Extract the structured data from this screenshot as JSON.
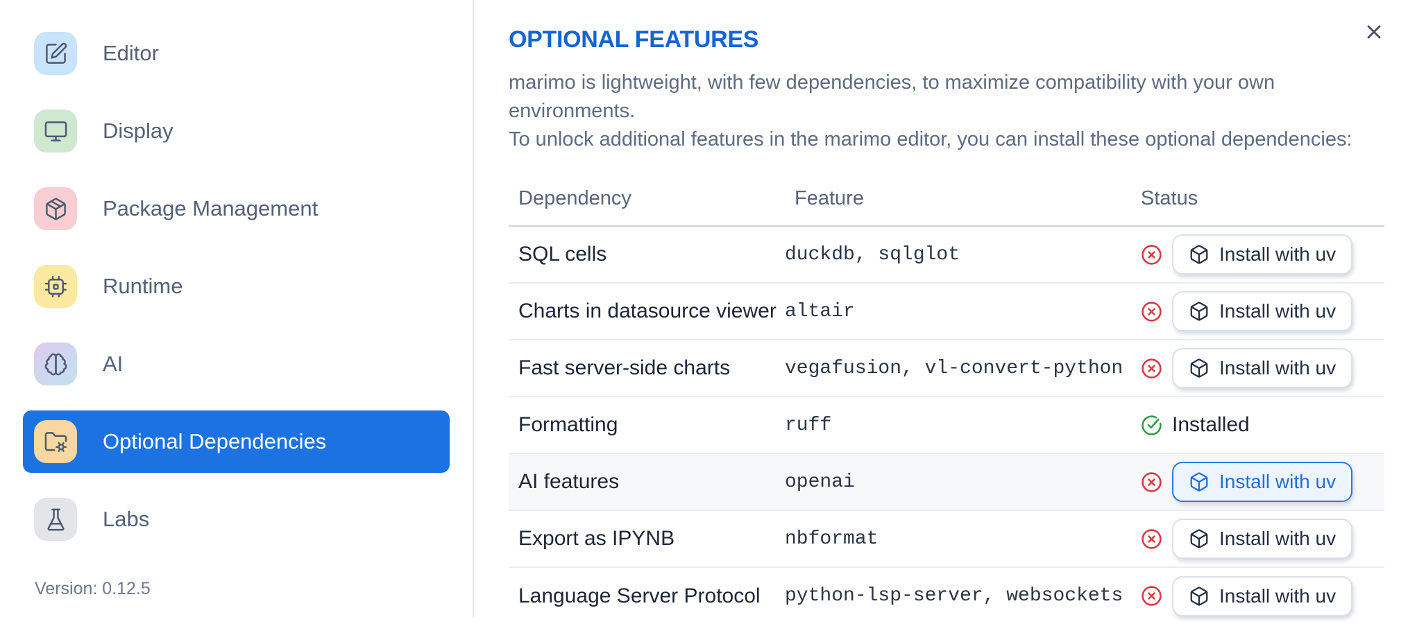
{
  "sidebar": {
    "items": [
      {
        "label": "Editor",
        "icon": "edit",
        "icon_bg": "#c8e4fa",
        "selected": false
      },
      {
        "label": "Display",
        "icon": "monitor",
        "icon_bg": "#cfe9d1",
        "selected": false
      },
      {
        "label": "Package Management",
        "icon": "package",
        "icon_bg": "#f9ced2",
        "selected": false
      },
      {
        "label": "Runtime",
        "icon": "cpu",
        "icon_bg": "#fbe8a1",
        "selected": false
      },
      {
        "label": "AI",
        "icon": "brain",
        "icon_bg": "linear-gradient(135deg,#dccaf2 0%,#c2e3ee 100%)",
        "selected": false
      },
      {
        "label": "Optional Dependencies",
        "icon": "folder-gear",
        "icon_bg": "#f8d8a0",
        "selected": true
      },
      {
        "label": "Labs",
        "icon": "flask",
        "icon_bg": "#e4e5e8",
        "selected": false
      }
    ],
    "version_label": "Version: 0.12.5"
  },
  "panel": {
    "title": "OPTIONAL FEATURES",
    "description_line1": "marimo is lightweight, with few dependencies, to maximize compatibility with your own environments.",
    "description_line2": "To unlock additional features in the marimo editor, you can install these optional dependencies:"
  },
  "table": {
    "columns": [
      "Dependency",
      "Feature",
      "Status"
    ],
    "install_button_label": "Install with uv",
    "installed_label": "Installed",
    "rows": [
      {
        "dependency": "SQL cells",
        "feature": "duckdb, sqlglot",
        "installed": false,
        "highlighted": false,
        "button_focused": false
      },
      {
        "dependency": "Charts in datasource viewer",
        "feature": "altair",
        "installed": false,
        "highlighted": false,
        "button_focused": false
      },
      {
        "dependency": "Fast server-side charts",
        "feature": "vegafusion, vl-convert-python",
        "installed": false,
        "highlighted": false,
        "button_focused": false
      },
      {
        "dependency": "Formatting",
        "feature": "ruff",
        "installed": true,
        "highlighted": false,
        "button_focused": false
      },
      {
        "dependency": "AI features",
        "feature": "openai",
        "installed": false,
        "highlighted": true,
        "button_focused": true
      },
      {
        "dependency": "Export as IPYNB",
        "feature": "nbformat",
        "installed": false,
        "highlighted": false,
        "button_focused": false
      },
      {
        "dependency": "Language Server Protocol",
        "feature": "python-lsp-server, websockets",
        "installed": false,
        "highlighted": false,
        "button_focused": false
      }
    ]
  },
  "colors": {
    "accent_blue": "#1d72e2",
    "heading_blue": "#1564d2",
    "status_error_red": "#d63945",
    "status_ok_green": "#2f9e44",
    "focused_button_blue": "#2b79e3"
  }
}
